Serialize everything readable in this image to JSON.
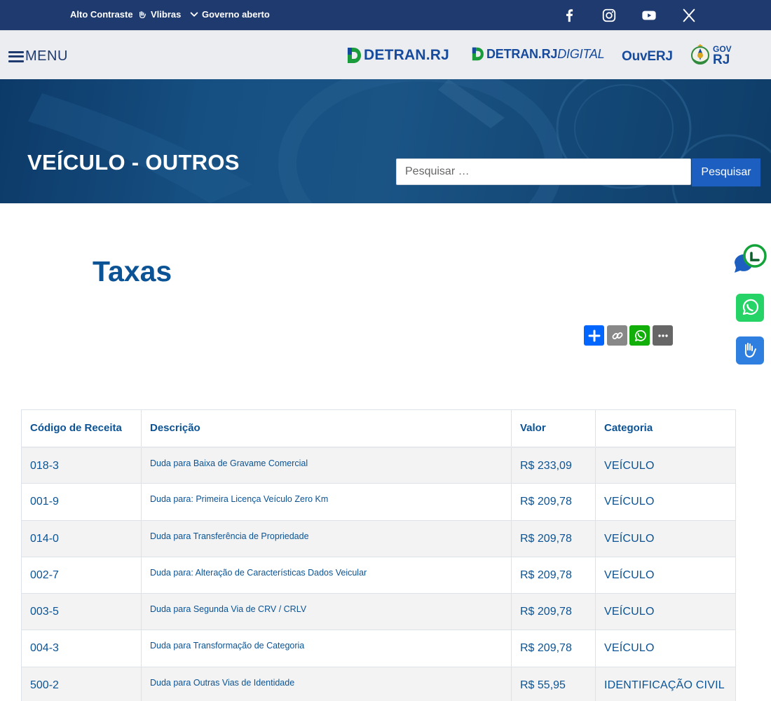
{
  "topbar": {
    "links": [
      {
        "label": "Alto Contraste"
      },
      {
        "label": "Vlibras"
      },
      {
        "label": "Governo aberto"
      }
    ]
  },
  "header": {
    "menu_label": "MENU",
    "logos": {
      "detran": "DETRAN.RJ",
      "detran_digital_main": "DETRAN.RJ",
      "detran_digital_suffix": "DIGITAL",
      "ouverj": "OuvERJ",
      "gov_line1": "GOV",
      "gov_line2": "RJ"
    }
  },
  "banner": {
    "title": "VEÍCULO - OUTROS",
    "search_placeholder": "Pesquisar …",
    "search_button": "Pesquisar"
  },
  "section": {
    "title": "Taxas"
  },
  "table": {
    "headers": [
      "Código de Receita",
      "Descrição",
      "Valor",
      "Categoria"
    ],
    "rows": [
      {
        "code": "018-3",
        "desc": "Duda para Baixa de Gravame Comercial",
        "value": "R$ 233,09",
        "category": "VEÍCULO"
      },
      {
        "code": "001-9",
        "desc": "Duda para: Primeira Licença Veículo Zero Km",
        "value": "R$ 209,78",
        "category": "VEÍCULO"
      },
      {
        "code": "014-0",
        "desc": "Duda para Transferência de Propriedade",
        "value": "R$ 209,78",
        "category": "VEÍCULO"
      },
      {
        "code": "002-7",
        "desc": "Duda para: Alteração de Características Dados Veicular",
        "value": "R$ 209,78",
        "category": "VEÍCULO"
      },
      {
        "code": "003-5",
        "desc": "Duda para Segunda Via de CRV / CRLV",
        "value": "R$ 209,78",
        "category": "VEÍCULO"
      },
      {
        "code": "004-3",
        "desc": "Duda para Transformação de Categoria",
        "value": "R$ 209,78",
        "category": "VEÍCULO"
      },
      {
        "code": "500-2",
        "desc": "Duda para Outras Vias de Identidade",
        "value": "R$ 55,95",
        "category": "IDENTIFICAÇÃO CIVIL"
      }
    ]
  },
  "colors": {
    "topbar": "#1f3a6e",
    "header_bg": "#ecedf0",
    "primary_text": "#0b5394",
    "search_button": "#1c5fc1",
    "share_add": "#0166ff",
    "share_copy": "#888888",
    "whatsapp": "#12af0a",
    "float_whatsapp": "#25d366",
    "float_libras": "#2f7fe0"
  },
  "icons": {
    "social": [
      "facebook-icon",
      "instagram-icon",
      "youtube-icon",
      "x-twitter-icon"
    ],
    "share": [
      "add-share-icon",
      "copy-link-icon",
      "whatsapp-share-icon",
      "more-share-icon"
    ],
    "floating": [
      "chat-icon",
      "whatsapp-icon",
      "libras-hands-icon"
    ]
  }
}
